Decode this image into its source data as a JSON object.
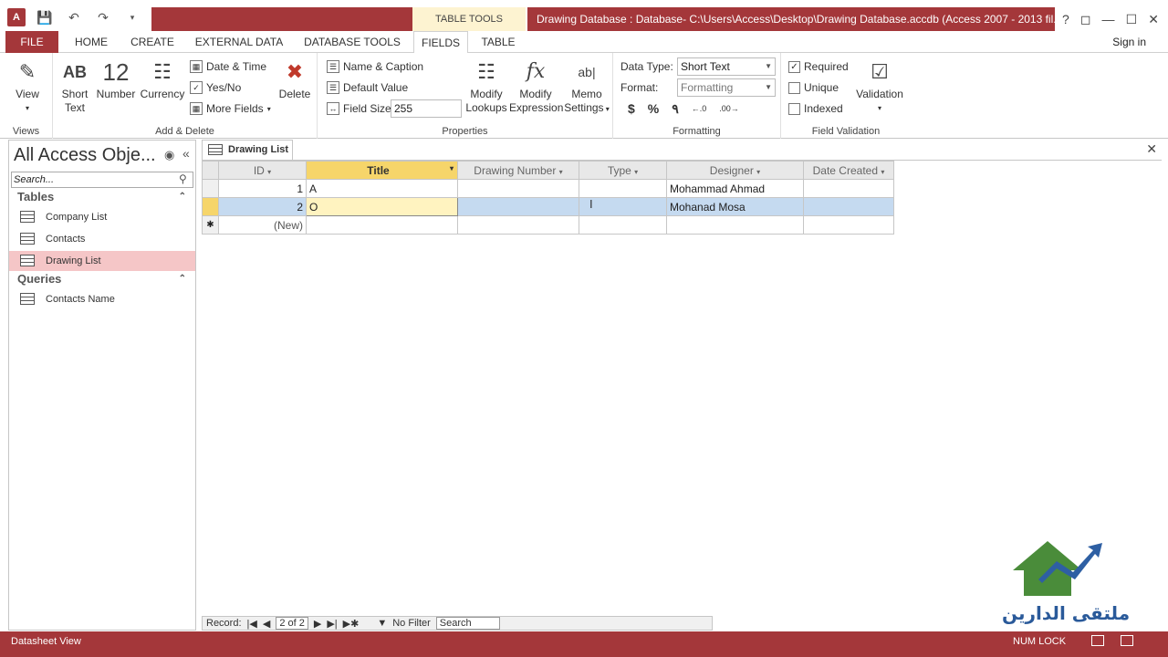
{
  "title_bar": {
    "app_icon": "A",
    "context_tab": "TABLE TOOLS",
    "window_title": "Drawing Database : Database- C:\\Users\\Access\\Desktop\\Drawing Database.accdb (Access 2007 - 2013 fil...",
    "help": "?"
  },
  "tabs": [
    {
      "label": "FILE"
    },
    {
      "label": "HOME"
    },
    {
      "label": "CREATE"
    },
    {
      "label": "EXTERNAL DATA"
    },
    {
      "label": "DATABASE TOOLS"
    },
    {
      "label": "FIELDS"
    },
    {
      "label": "TABLE"
    }
  ],
  "sign_in": "Sign in",
  "ribbon": {
    "views": {
      "label": "Views",
      "view_btn": "View"
    },
    "add_delete": {
      "label": "Add & Delete",
      "short_text_1": "Short",
      "short_text_2": "Text",
      "short_text_icon": "AB",
      "number": "Number",
      "number_icon": "12",
      "currency": "Currency",
      "date_time": "Date & Time",
      "yes_no": "Yes/No",
      "more_fields": "More Fields",
      "delete": "Delete"
    },
    "properties": {
      "label": "Properties",
      "name_caption": "Name & Caption",
      "default_value": "Default Value",
      "field_size_label": "Field Size",
      "field_size_value": "255",
      "modify_lookups_1": "Modify",
      "modify_lookups_2": "Lookups",
      "modify_expr_1": "Modify",
      "modify_expr_2": "Expression",
      "memo_1": "Memo",
      "memo_2": "Settings"
    },
    "formatting": {
      "label": "Formatting",
      "data_type_label": "Data Type:",
      "data_type_value": "Short Text",
      "format_label": "Format:",
      "format_value": "Formatting",
      "currency_sym": "$",
      "percent_sym": "%",
      "comma_sym": "٩"
    },
    "validation": {
      "label": "Field Validation",
      "required": "Required",
      "unique": "Unique",
      "indexed": "Indexed",
      "validation_btn": "Validation"
    }
  },
  "nav": {
    "title": "All Access Obje...",
    "search_placeholder": "Search...",
    "tables_header": "Tables",
    "tables": [
      "Company List",
      "Contacts",
      "Drawing List"
    ],
    "queries_header": "Queries",
    "queries": [
      "Contacts Name"
    ]
  },
  "document_tab": "Drawing List",
  "datasheet": {
    "columns": [
      "ID",
      "Title",
      "Drawing Number",
      "Type",
      "Designer",
      "Date Created"
    ],
    "rows": [
      {
        "id": "1",
        "title": "A",
        "designer": "Mohammad Ahmad"
      },
      {
        "id": "2",
        "title": "O",
        "designer": "Mohanad Mosa"
      }
    ],
    "new_row": "(New)"
  },
  "record_nav": {
    "label": "Record:",
    "position": "2 of 2",
    "filter": "No Filter",
    "search": "Search"
  },
  "status": {
    "view": "Datasheet View",
    "num_lock": "NUM LOCK"
  },
  "logo_text": "ملتقى الدارين",
  "colors": {
    "accent": "#a4373a",
    "title_header": "#f6d56a",
    "row_selection": "#c5daf0"
  }
}
